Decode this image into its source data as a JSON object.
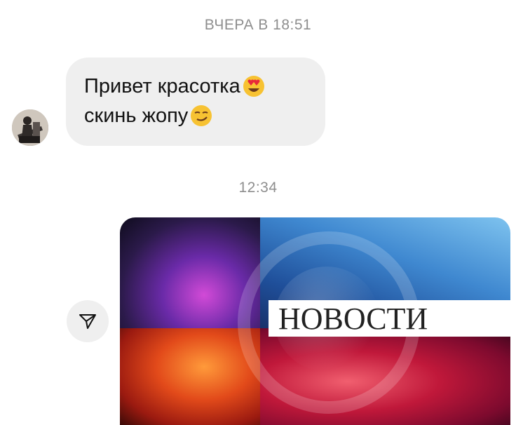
{
  "messages": {
    "timestamp_1": "ВЧЕРА В 18:51",
    "incoming": {
      "line_1": "Привет красотка",
      "line_1_emoji": "smiling-face-with-heart-eyes-icon",
      "line_2": "скинь жопу",
      "line_2_emoji": "smirking-face-icon"
    },
    "timestamp_2": "12:34",
    "outgoing_media": {
      "banner_text": "НОВОСТИ"
    }
  },
  "icons": {
    "share": "paper-plane-icon",
    "avatar": "user-avatar"
  },
  "colors": {
    "bubble_background": "#efefef",
    "timestamp": "#8e8e8e",
    "text": "#111111"
  }
}
